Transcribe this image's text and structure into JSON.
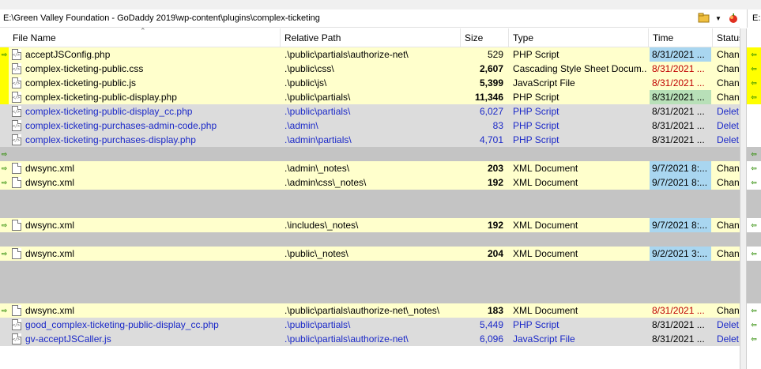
{
  "window": {
    "left_path": "E:\\Green Valley Foundation - GoDaddy  2019\\wp-content\\plugins\\complex-ticketing",
    "right_path": "E:"
  },
  "toolbar": {
    "folder_icon": "folder-icon",
    "dropdown_icon": "chevron-down-icon",
    "apple_icon": "apple-icon"
  },
  "columns": {
    "name": "File Name",
    "path": "Relative Path",
    "size": "Size",
    "type": "Type",
    "time": "Time",
    "status": "Status"
  },
  "colors": {
    "changed_row": "#ffffcc",
    "deleted_row": "#dcdcdc",
    "gap_row": "#c4c4c4",
    "deleted_text": "#1a28c8",
    "newer_time_red": "#c00000",
    "time_blue": "#a9d6f0",
    "time_green": "#b8e0b8",
    "marker_yellow": "#ffff00",
    "arrow_green": "#2a8a00"
  },
  "rows": [
    {
      "kind": "changed",
      "icon": "code",
      "name": "acceptJSConfig.php",
      "path": ".\\public\\partials\\authorize-net\\",
      "size": "529",
      "bold": false,
      "type": "PHP Script",
      "time": "8/31/2021 ...",
      "time_style": "blue",
      "status": "Chan"
    },
    {
      "kind": "changed",
      "icon": "code",
      "name": "complex-ticketing-public.css",
      "path": ".\\public\\css\\",
      "size": "2,607",
      "bold": true,
      "type": "Cascading Style Sheet Docum...",
      "time": "8/31/2021 ...",
      "time_style": "red",
      "status": "Chan"
    },
    {
      "kind": "changed",
      "icon": "code",
      "name": "complex-ticketing-public.js",
      "path": ".\\public\\js\\",
      "size": "5,399",
      "bold": true,
      "type": "JavaScript File",
      "time": "8/31/2021 ...",
      "time_style": "red",
      "status": "Chan"
    },
    {
      "kind": "changed",
      "icon": "code",
      "name": "complex-ticketing-public-display.php",
      "path": ".\\public\\partials\\",
      "size": "11,346",
      "bold": true,
      "type": "PHP Script",
      "time": "8/31/2021 ...",
      "time_style": "green",
      "status": "Chan"
    },
    {
      "kind": "deleted",
      "icon": "code",
      "name": "complex-ticketing-public-display_cc.php",
      "path": ".\\public\\partials\\",
      "size": "6,027",
      "bold": false,
      "type": "PHP Script",
      "time": "8/31/2021 ...",
      "time_style": "plain",
      "status": "Delet"
    },
    {
      "kind": "deleted",
      "icon": "code",
      "name": "complex-ticketing-purchases-admin-code.php",
      "path": ".\\admin\\",
      "size": "83",
      "bold": false,
      "type": "PHP Script",
      "time": "8/31/2021 ...",
      "time_style": "plain",
      "status": "Delet"
    },
    {
      "kind": "deleted",
      "icon": "code",
      "name": "complex-ticketing-purchases-display.php",
      "path": ".\\admin\\partials\\",
      "size": "4,701",
      "bold": false,
      "type": "PHP Script",
      "time": "8/31/2021 ...",
      "time_style": "plain",
      "status": "Delet"
    },
    {
      "kind": "gap"
    },
    {
      "kind": "changed",
      "icon": "doc",
      "name": "dwsync.xml",
      "path": ".\\admin\\_notes\\",
      "size": "203",
      "bold": true,
      "type": "XML Document",
      "time": "9/7/2021 8:...",
      "time_style": "blue",
      "status": "Chan"
    },
    {
      "kind": "changed",
      "icon": "doc",
      "name": "dwsync.xml",
      "path": ".\\admin\\css\\_notes\\",
      "size": "192",
      "bold": true,
      "type": "XML Document",
      "time": "9/7/2021 8:...",
      "time_style": "blue",
      "status": "Chan"
    },
    {
      "kind": "gap"
    },
    {
      "kind": "gap"
    },
    {
      "kind": "changed",
      "icon": "doc",
      "name": "dwsync.xml",
      "path": ".\\includes\\_notes\\",
      "size": "192",
      "bold": true,
      "type": "XML Document",
      "time": "9/7/2021 8:...",
      "time_style": "blue",
      "status": "Chan"
    },
    {
      "kind": "gap"
    },
    {
      "kind": "changed",
      "icon": "doc",
      "name": "dwsync.xml",
      "path": ".\\public\\_notes\\",
      "size": "204",
      "bold": true,
      "type": "XML Document",
      "time": "9/2/2021 3:...",
      "time_style": "blue",
      "status": "Chan"
    },
    {
      "kind": "gap"
    },
    {
      "kind": "gap"
    },
    {
      "kind": "gap"
    },
    {
      "kind": "changed",
      "icon": "doc",
      "name": "dwsync.xml",
      "path": ".\\public\\partials\\authorize-net\\_notes\\",
      "size": "183",
      "bold": true,
      "type": "XML Document",
      "time": "8/31/2021 ...",
      "time_style": "red",
      "status": "Chan"
    },
    {
      "kind": "deleted",
      "icon": "code",
      "name": "good_complex-ticketing-public-display_cc.php",
      "path": ".\\public\\partials\\",
      "size": "5,449",
      "bold": false,
      "type": "PHP Script",
      "time": "8/31/2021 ...",
      "time_style": "plain",
      "status": "Delet"
    },
    {
      "kind": "deleted",
      "icon": "code",
      "name": "gv-acceptJSCaller.js",
      "path": ".\\public\\partials\\authorize-net\\",
      "size": "6,096",
      "bold": false,
      "type": "JavaScript File",
      "time": "8/31/2021 ...",
      "time_style": "plain",
      "status": "Delet"
    }
  ]
}
